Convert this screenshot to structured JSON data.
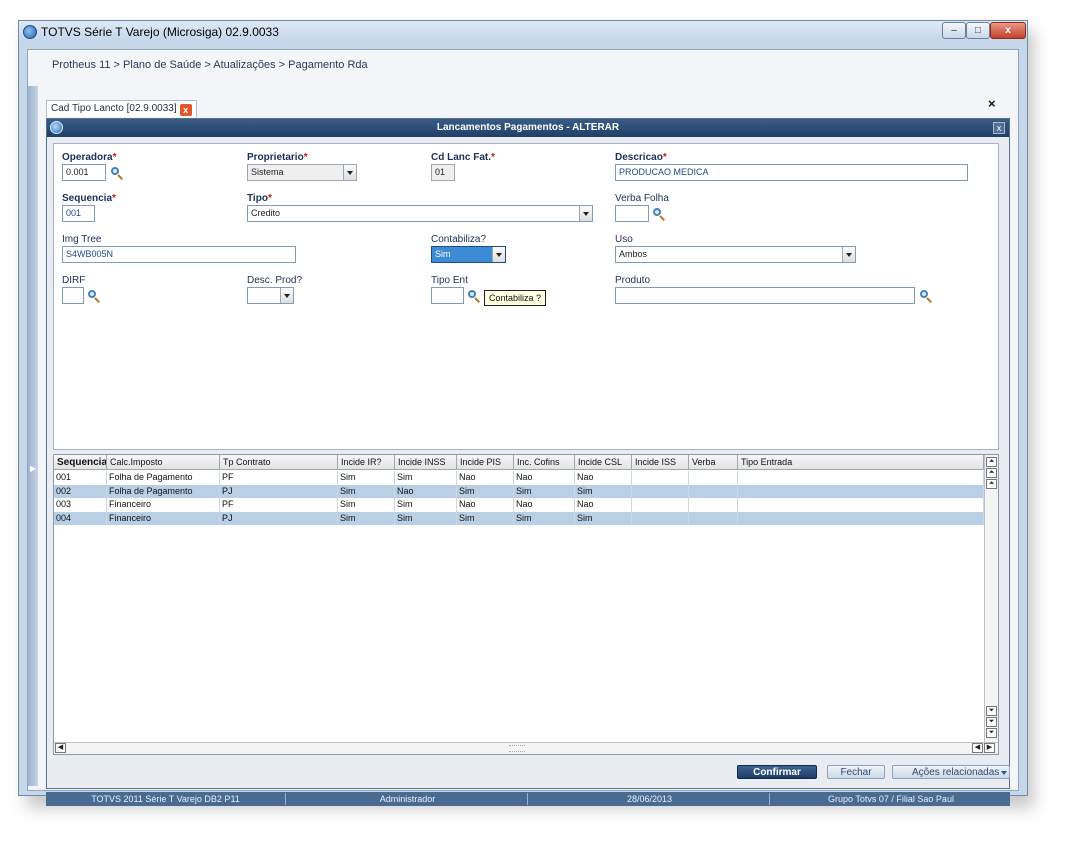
{
  "window": {
    "title": "TOTVS Série T Varejo (Microsiga) 02.9.0033",
    "min": "–",
    "max": "□",
    "close": "x"
  },
  "breadcrumb": "Protheus 11 > Plano de Saúde > Atualizações > Pagamento Rda",
  "tab": {
    "label": "Cad Tipo Lancto [02.9.0033]",
    "close": "x",
    "outer_close": "×"
  },
  "dialog": {
    "title": "Lancamentos Pagamentos - ALTERAR",
    "close": "x"
  },
  "form": {
    "operadora": {
      "label": "Operadora",
      "value": "0.001"
    },
    "proprietario": {
      "label": "Proprietario",
      "value": "Sistema"
    },
    "cd_lanc_fat": {
      "label": "Cd Lanc Fat.",
      "value": "01"
    },
    "descricao": {
      "label": "Descricao",
      "value": "PRODUCAO MEDICA"
    },
    "sequencia": {
      "label": "Sequencia",
      "value": "001"
    },
    "tipo": {
      "label": "Tipo",
      "value": "Credito"
    },
    "verba_folha": {
      "label": "Verba Folha",
      "value": ""
    },
    "img_tree": {
      "label": "Img Tree",
      "value": "S4WB005N"
    },
    "contabiliza": {
      "label": "Contabiliza?",
      "value": "Sim"
    },
    "uso": {
      "label": "Uso",
      "value": "Ambos"
    },
    "dirf": {
      "label": "DIRF",
      "value": ""
    },
    "desc_prod": {
      "label": "Desc. Prod?",
      "value": ""
    },
    "tipo_entrada": {
      "label": "Tipo Ent",
      "value": ""
    },
    "produto": {
      "label": "Produto",
      "value": ""
    },
    "required_mark": "*"
  },
  "tooltip": "Contabiliza ?",
  "grid": {
    "columns": [
      "Sequencia",
      "Calc.Imposto",
      "Tp Contrato",
      "Incide IR?",
      "Incide INSS",
      "Incide PIS",
      "Inc. Cofins",
      "Incide CSL",
      "Incide ISS",
      "Verba",
      "Tipo Entrada"
    ],
    "rows": [
      [
        "001",
        "Folha de Pagamento",
        "PF",
        "Sim",
        "Sim",
        "Nao",
        "Nao",
        "Nao",
        "",
        "",
        ""
      ],
      [
        "002",
        "Folha de Pagamento",
        "PJ",
        "Sim",
        "Nao",
        "Sim",
        "Sim",
        "Sim",
        "",
        "",
        ""
      ],
      [
        "003",
        "Financeiro",
        "PF",
        "Sim",
        "Sim",
        "Nao",
        "Nao",
        "Nao",
        "",
        "",
        ""
      ],
      [
        "004",
        "Financeiro",
        "PJ",
        "Sim",
        "Sim",
        "Sim",
        "Sim",
        "Sim",
        "",
        "",
        ""
      ]
    ],
    "scroll": {
      "top": "⏶",
      "up": "⏶",
      "down": "⏷",
      "bottom": "⏷",
      "left": "◀",
      "right": "▶"
    }
  },
  "buttons": {
    "confirmar": "Confirmar",
    "fechar": "Fechar",
    "acoes": "Ações relacionadas"
  },
  "status": {
    "product": "TOTVS 2011 Série T Varejo DB2 P11",
    "user": "Administrador",
    "date": "28/06/2013",
    "company": "Grupo Totvs 07 / Filial Sao Paul"
  },
  "icons": {
    "search": "search-icon",
    "dropdown": "chevron-down-icon",
    "close": "close-icon",
    "app": "totvs-logo-icon"
  },
  "colors": {
    "title_bar": "#1f3f67",
    "row_alt": "#b8cfe6",
    "accent": "#3e6390",
    "required": "#cc1111"
  }
}
